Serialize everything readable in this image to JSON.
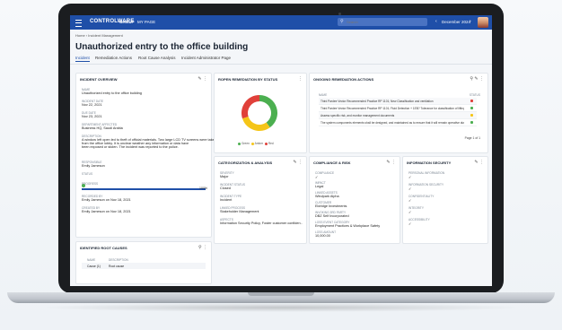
{
  "app": {
    "brand": "CONTROLWARE",
    "nav": [
      "GROUP",
      "MY PAGE"
    ],
    "search_placeholder": "Search",
    "date": "December 2024",
    "date_prev": "‹",
    "date_next": "›"
  },
  "breadcrumb": "Home  ›  Incident Management",
  "page_title": "Unauthorized entry to the office building",
  "tabs": [
    "Incident",
    "Remediation Actions",
    "Root Cause Analysis",
    "Incident Administrator Page"
  ],
  "incident_overview": {
    "title": "INCIDENT OVERVIEW",
    "fields": [
      {
        "label": "NAME",
        "value": "Unauthorized entry to the office building"
      },
      {
        "label": "INCIDENT DATE",
        "value": "Nov 22, 2021"
      },
      {
        "label": "DUE DATE",
        "value": "Nov 23, 2021"
      },
      {
        "label": "DEPARTMENT AFFECTED",
        "value": "Business HQ, Saudi Arabia"
      }
    ],
    "description_label": "DESCRIPTION",
    "description": [
      "A window left open led to theft of official materials. Two large LCD TV screens were taken",
      "from the office lobby. It is unclear weather any information or data have",
      "been exposed or stolen. The incident was reported to the police."
    ],
    "responsible_label": "RESPONSIBLE",
    "responsible": "Emily Jameson",
    "status_label": "STATUS",
    "progress_label": "PROGRESS",
    "progress_value": 100,
    "progress_text": "100%",
    "recorded_by_label": "RECORDED BY",
    "recorded_by": "Emily Jameson on Nov 18, 2021",
    "created_by_label": "CREATED BY",
    "created_by": "Emily Jameson on Nov 18, 2021"
  },
  "root_causes": {
    "title": "IDENTIFIED ROOT CAUSES",
    "columns": [
      "NAME",
      "DESCRIPTION"
    ],
    "rows": [
      [
        "Cause (1)",
        "Root cause"
      ]
    ]
  },
  "remediation_status": {
    "title": "ROPEN REMEDIATION BY STATUS",
    "legend": [
      "Green",
      "Amber",
      "Red"
    ],
    "colors": [
      "#4caf50",
      "#f5c518",
      "#e0403a"
    ],
    "values": [
      40,
      30,
      30
    ]
  },
  "ongoing_actions": {
    "title": "ONGOING REMEDIATION ACTIONS",
    "columns": [
      "NAME",
      "STATUS"
    ],
    "rows": [
      {
        "name": "Third Pardee Vector Recommended Practice RP 1101; New Classification and ventilation",
        "color": "#e0403a"
      },
      {
        "name": "Third Pardee Vector Recommended Practice RP 1101; Fluid Detection + 1EB? Tolerance for classification of lifting appliance",
        "color": "#4caf50"
      },
      {
        "name": "Assess specific risk, and monitor management documents",
        "color": "#f5c518"
      },
      {
        "name": "The system components elements shall be designed, and maintained as to ensure that it will remain operative during leakage",
        "color": "#4caf50"
      }
    ],
    "pager": "Page 1 of 1"
  },
  "categorization": {
    "title": "CATEGORIZATION & ANALYSIS",
    "fields": [
      {
        "label": "SEVERITY",
        "value": "Major"
      },
      {
        "label": "INCIDENT STATUS",
        "value": "Closed"
      },
      {
        "label": "INCIDENT TYPE",
        "value": "Incident"
      },
      {
        "label": "LINKED PROCESS",
        "value": "Stakeholder Management"
      },
      {
        "label": "ASPECTS",
        "value": "Information Security Policy, Foster customer confiden..."
      }
    ]
  },
  "compliance": {
    "title": "COMPLIANCE & RISK",
    "fields": [
      {
        "label": "COMPLIANCE",
        "value": "✓"
      },
      {
        "label": "IMPACT",
        "value": "Legal"
      },
      {
        "label": "LINKED ASSETS",
        "value": "Windpark Alpha"
      },
      {
        "label": "CUSTOMER",
        "value": "Eldridge Investments"
      },
      {
        "label": "INVOKING 3RD PARTY",
        "value": "DBZ Self Incorporated"
      },
      {
        "label": "LOSS EVENT CATEGORY",
        "value": "Employment Practices & Workplace Safety"
      },
      {
        "label": "LOSS AMOUNT",
        "value": "10,000.00"
      }
    ]
  },
  "info_security": {
    "title": "INFORMATION SECURITY",
    "fields": [
      {
        "label": "PERSONAL INFORMATION",
        "value": "✓"
      },
      {
        "label": "INFORMATION SECURITY",
        "value": "✓"
      },
      {
        "label": "CONFIDENTIALITY",
        "value": "✓"
      },
      {
        "label": "INTEGRITY",
        "value": "✓"
      },
      {
        "label": "ACCESSIBILITY",
        "value": "✓"
      }
    ]
  }
}
